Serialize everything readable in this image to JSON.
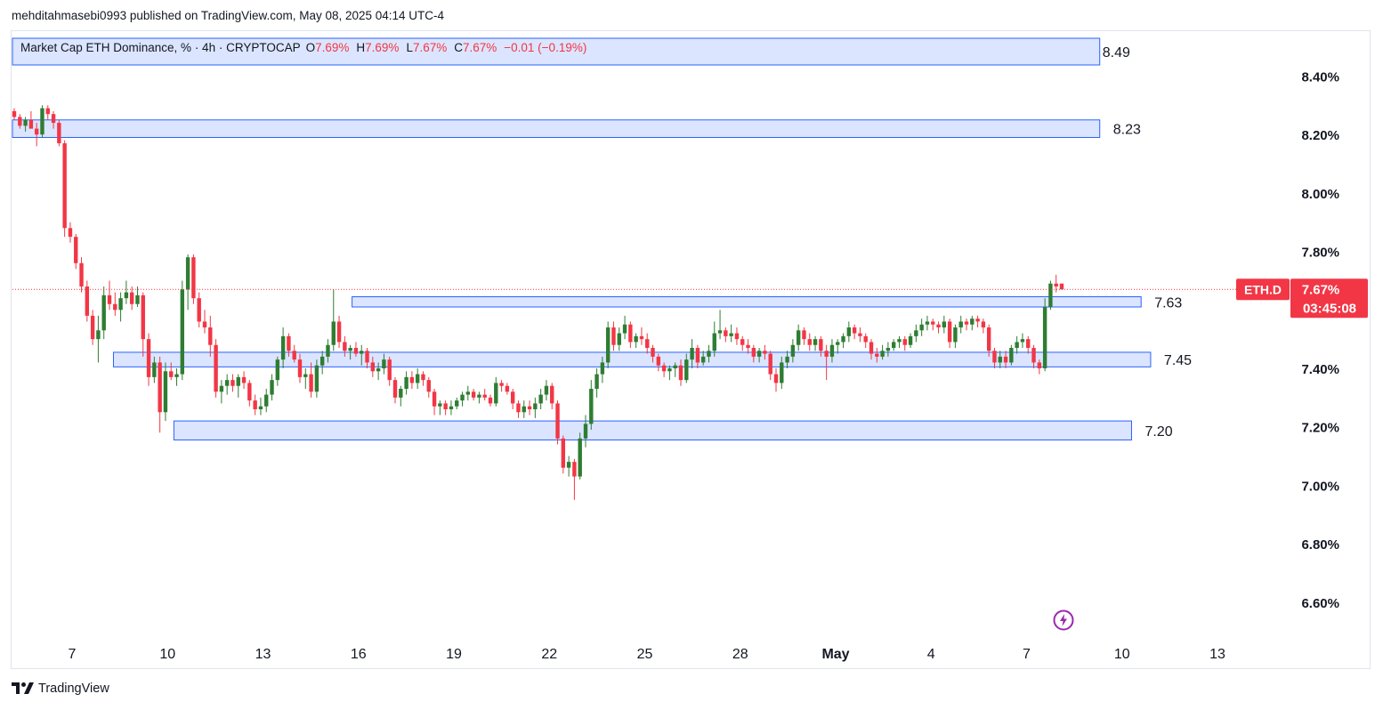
{
  "header": {
    "publisher_line": "mehditahmasebi0993 published on TradingView.com, May 08, 2025 04:14 UTC-4"
  },
  "legend": {
    "title": "Market Cap ETH Dominance, % · 4h · CRYPTOCAP",
    "o_label": "O",
    "o_value": "7.69%",
    "h_label": "H",
    "h_value": "7.69%",
    "l_label": "L",
    "l_value": "7.67%",
    "c_label": "C",
    "c_value": "7.67%",
    "change": "−0.01 (−0.19%)"
  },
  "price_tag": {
    "symbol": "ETH.D",
    "price": "7.67%",
    "countdown": "03:45:08"
  },
  "footer": {
    "brand": "TradingView"
  },
  "icons": {
    "live": "lightning-icon",
    "logo": "tradingview-logo-icon"
  },
  "colors": {
    "up": "#22ab94",
    "up_body": "#2e7d32",
    "down": "#f23645",
    "zone_fill": "#d6e0ff",
    "zone_stroke": "#2962ff",
    "axis_text": "#131722",
    "last_price_line": "#f23645",
    "live_icon": "#9c27b0"
  },
  "chart_data": {
    "type": "candlestick",
    "symbol": "ETH.D",
    "timeframe": "4h",
    "y_axis": {
      "range": [
        6.5,
        8.55
      ],
      "ticks": [
        {
          "value": 8.4,
          "label": "8.40%"
        },
        {
          "value": 8.2,
          "label": "8.20%"
        },
        {
          "value": 8.0,
          "label": "8.00%"
        },
        {
          "value": 7.8,
          "label": "7.80%"
        },
        {
          "value": 7.4,
          "label": "7.40%"
        },
        {
          "value": 7.2,
          "label": "7.20%"
        },
        {
          "value": 7.0,
          "label": "7.00%"
        },
        {
          "value": 6.8,
          "label": "6.80%"
        },
        {
          "value": 6.6,
          "label": "6.60%"
        }
      ]
    },
    "x_axis": {
      "range_days": [
        -1.4,
        38.4
      ],
      "ticks": [
        {
          "day": 3,
          "label": "7"
        },
        {
          "day": 6,
          "label": "10"
        },
        {
          "day": 9,
          "label": "13"
        },
        {
          "day": 12,
          "label": "16"
        },
        {
          "day": 15,
          "label": "19"
        },
        {
          "day": 18,
          "label": "22"
        },
        {
          "day": 21,
          "label": "25"
        },
        {
          "day": 24,
          "label": "28"
        },
        {
          "day": 27,
          "label": "May",
          "bold": true
        },
        {
          "day": 30,
          "label": "4"
        },
        {
          "day": 33,
          "label": "7"
        },
        {
          "day": 36,
          "label": "10"
        },
        {
          "day": 39,
          "label": "13"
        }
      ]
    },
    "zones": [
      {
        "name": "zone-8-49",
        "label": "8.49",
        "start_day": 0.0,
        "end_day": 32.3,
        "low": 8.45,
        "high": 8.55
      },
      {
        "name": "zone-8-23",
        "label": "8.23",
        "start_day": 0.0,
        "end_day": 32.3,
        "low": 8.19,
        "high": 8.25
      },
      {
        "name": "zone-7-63",
        "label": "7.63",
        "start_day": 9.3,
        "end_day": 33.6,
        "low": 7.61,
        "high": 7.645
      },
      {
        "name": "zone-7-45",
        "label": "7.45",
        "start_day": 1.8,
        "end_day": 33.9,
        "low": 7.405,
        "high": 7.455
      },
      {
        "name": "zone-7-20",
        "label": "7.20",
        "start_day": 3.7,
        "end_day": 33.3,
        "low": 7.155,
        "high": 7.22
      }
    ],
    "last_price": 7.67,
    "candles": [
      [
        8.28,
        8.29,
        8.25,
        8.26
      ],
      [
        8.26,
        8.27,
        8.22,
        8.23
      ],
      [
        8.23,
        8.26,
        8.21,
        8.25
      ],
      [
        8.25,
        8.28,
        8.24,
        8.22
      ],
      [
        8.22,
        8.24,
        8.16,
        8.2
      ],
      [
        8.2,
        8.3,
        8.19,
        8.29
      ],
      [
        8.29,
        8.3,
        8.25,
        8.27
      ],
      [
        8.27,
        8.28,
        8.22,
        8.24
      ],
      [
        8.24,
        8.25,
        8.16,
        8.17
      ],
      [
        8.17,
        8.18,
        7.85,
        7.88
      ],
      [
        7.88,
        7.9,
        7.83,
        7.85
      ],
      [
        7.85,
        7.86,
        7.74,
        7.76
      ],
      [
        7.76,
        7.78,
        7.66,
        7.68
      ],
      [
        7.68,
        7.7,
        7.56,
        7.58
      ],
      [
        7.58,
        7.6,
        7.48,
        7.5
      ],
      [
        7.5,
        7.58,
        7.42,
        7.53
      ],
      [
        7.53,
        7.68,
        7.5,
        7.65
      ],
      [
        7.65,
        7.7,
        7.6,
        7.62
      ],
      [
        7.62,
        7.66,
        7.58,
        7.6
      ],
      [
        7.6,
        7.66,
        7.56,
        7.64
      ],
      [
        7.64,
        7.7,
        7.62,
        7.66
      ],
      [
        7.66,
        7.68,
        7.6,
        7.62
      ],
      [
        7.62,
        7.68,
        7.61,
        7.65
      ],
      [
        7.65,
        7.66,
        7.44,
        7.5
      ],
      [
        7.5,
        7.52,
        7.34,
        7.37
      ],
      [
        7.37,
        7.44,
        7.35,
        7.42
      ],
      [
        7.42,
        7.44,
        7.18,
        7.25
      ],
      [
        7.25,
        7.42,
        7.22,
        7.39
      ],
      [
        7.39,
        7.42,
        7.36,
        7.37
      ],
      [
        7.37,
        7.4,
        7.34,
        7.38
      ],
      [
        7.38,
        7.7,
        7.36,
        7.67
      ],
      [
        7.67,
        7.79,
        7.6,
        7.78
      ],
      [
        7.78,
        7.79,
        7.62,
        7.64
      ],
      [
        7.64,
        7.66,
        7.54,
        7.56
      ],
      [
        7.56,
        7.6,
        7.52,
        7.54
      ],
      [
        7.54,
        7.58,
        7.44,
        7.48
      ],
      [
        7.48,
        7.5,
        7.3,
        7.32
      ],
      [
        7.32,
        7.36,
        7.28,
        7.34
      ],
      [
        7.34,
        7.38,
        7.31,
        7.36
      ],
      [
        7.36,
        7.38,
        7.32,
        7.34
      ],
      [
        7.34,
        7.38,
        7.3,
        7.37
      ],
      [
        7.37,
        7.39,
        7.33,
        7.35
      ],
      [
        7.35,
        7.36,
        7.27,
        7.29
      ],
      [
        7.29,
        7.31,
        7.24,
        7.26
      ],
      [
        7.26,
        7.3,
        7.24,
        7.27
      ],
      [
        7.27,
        7.33,
        7.25,
        7.31
      ],
      [
        7.31,
        7.38,
        7.29,
        7.36
      ],
      [
        7.36,
        7.44,
        7.34,
        7.43
      ],
      [
        7.43,
        7.54,
        7.4,
        7.51
      ],
      [
        7.51,
        7.52,
        7.44,
        7.46
      ],
      [
        7.46,
        7.48,
        7.42,
        7.43
      ],
      [
        7.43,
        7.45,
        7.35,
        7.37
      ],
      [
        7.37,
        7.4,
        7.33,
        7.38
      ],
      [
        7.38,
        7.42,
        7.3,
        7.32
      ],
      [
        7.32,
        7.43,
        7.3,
        7.41
      ],
      [
        7.41,
        7.46,
        7.38,
        7.44
      ],
      [
        7.44,
        7.5,
        7.42,
        7.48
      ],
      [
        7.48,
        7.67,
        7.46,
        7.56
      ],
      [
        7.56,
        7.58,
        7.47,
        7.49
      ],
      [
        7.49,
        7.51,
        7.44,
        7.46
      ],
      [
        7.46,
        7.48,
        7.43,
        7.47
      ],
      [
        7.47,
        7.49,
        7.44,
        7.45
      ],
      [
        7.45,
        7.48,
        7.41,
        7.46
      ],
      [
        7.46,
        7.47,
        7.4,
        7.42
      ],
      [
        7.42,
        7.44,
        7.37,
        7.39
      ],
      [
        7.39,
        7.42,
        7.36,
        7.4
      ],
      [
        7.4,
        7.45,
        7.38,
        7.43
      ],
      [
        7.43,
        7.44,
        7.34,
        7.36
      ],
      [
        7.36,
        7.37,
        7.28,
        7.3
      ],
      [
        7.3,
        7.34,
        7.27,
        7.33
      ],
      [
        7.33,
        7.39,
        7.31,
        7.37
      ],
      [
        7.37,
        7.39,
        7.33,
        7.35
      ],
      [
        7.35,
        7.4,
        7.33,
        7.38
      ],
      [
        7.38,
        7.39,
        7.34,
        7.36
      ],
      [
        7.36,
        7.37,
        7.3,
        7.32
      ],
      [
        7.32,
        7.33,
        7.24,
        7.27
      ],
      [
        7.27,
        7.29,
        7.24,
        7.28
      ],
      [
        7.28,
        7.29,
        7.24,
        7.26
      ],
      [
        7.26,
        7.29,
        7.24,
        7.27
      ],
      [
        7.27,
        7.3,
        7.26,
        7.29
      ],
      [
        7.29,
        7.32,
        7.27,
        7.31
      ],
      [
        7.31,
        7.34,
        7.29,
        7.32
      ],
      [
        7.32,
        7.33,
        7.29,
        7.3
      ],
      [
        7.3,
        7.32,
        7.28,
        7.31
      ],
      [
        7.31,
        7.33,
        7.29,
        7.3
      ],
      [
        7.3,
        7.31,
        7.27,
        7.28
      ],
      [
        7.28,
        7.37,
        7.27,
        7.35
      ],
      [
        7.35,
        7.36,
        7.32,
        7.34
      ],
      [
        7.34,
        7.35,
        7.31,
        7.32
      ],
      [
        7.32,
        7.33,
        7.26,
        7.28
      ],
      [
        7.28,
        7.29,
        7.23,
        7.25
      ],
      [
        7.25,
        7.29,
        7.23,
        7.27
      ],
      [
        7.27,
        7.29,
        7.24,
        7.26
      ],
      [
        7.26,
        7.3,
        7.23,
        7.28
      ],
      [
        7.28,
        7.33,
        7.26,
        7.31
      ],
      [
        7.31,
        7.36,
        7.29,
        7.34
      ],
      [
        7.34,
        7.35,
        7.26,
        7.28
      ],
      [
        7.28,
        7.29,
        7.14,
        7.16
      ],
      [
        7.16,
        7.17,
        7.04,
        7.06
      ],
      [
        7.06,
        7.1,
        7.03,
        7.08
      ],
      [
        7.08,
        7.09,
        6.95,
        7.03
      ],
      [
        7.03,
        7.18,
        7.02,
        7.16
      ],
      [
        7.16,
        7.24,
        7.13,
        7.21
      ],
      [
        7.21,
        7.36,
        7.19,
        7.33
      ],
      [
        7.33,
        7.4,
        7.3,
        7.38
      ],
      [
        7.38,
        7.44,
        7.35,
        7.42
      ],
      [
        7.42,
        7.56,
        7.4,
        7.54
      ],
      [
        7.54,
        7.56,
        7.46,
        7.48
      ],
      [
        7.48,
        7.54,
        7.46,
        7.52
      ],
      [
        7.52,
        7.58,
        7.5,
        7.55
      ],
      [
        7.55,
        7.56,
        7.47,
        7.49
      ],
      [
        7.49,
        7.52,
        7.47,
        7.51
      ],
      [
        7.51,
        7.54,
        7.48,
        7.5
      ],
      [
        7.5,
        7.52,
        7.45,
        7.47
      ],
      [
        7.47,
        7.48,
        7.42,
        7.44
      ],
      [
        7.44,
        7.45,
        7.39,
        7.41
      ],
      [
        7.41,
        7.42,
        7.37,
        7.39
      ],
      [
        7.39,
        7.41,
        7.36,
        7.4
      ],
      [
        7.4,
        7.42,
        7.37,
        7.41
      ],
      [
        7.41,
        7.43,
        7.34,
        7.36
      ],
      [
        7.36,
        7.45,
        7.35,
        7.43
      ],
      [
        7.43,
        7.5,
        7.4,
        7.47
      ],
      [
        7.47,
        7.48,
        7.4,
        7.42
      ],
      [
        7.42,
        7.46,
        7.41,
        7.44
      ],
      [
        7.44,
        7.48,
        7.42,
        7.46
      ],
      [
        7.46,
        7.56,
        7.44,
        7.52
      ],
      [
        7.52,
        7.6,
        7.5,
        7.53
      ],
      [
        7.53,
        7.54,
        7.49,
        7.51
      ],
      [
        7.51,
        7.55,
        7.49,
        7.52
      ],
      [
        7.52,
        7.54,
        7.48,
        7.5
      ],
      [
        7.5,
        7.51,
        7.46,
        7.48
      ],
      [
        7.48,
        7.5,
        7.45,
        7.47
      ],
      [
        7.47,
        7.48,
        7.42,
        7.44
      ],
      [
        7.44,
        7.47,
        7.42,
        7.46
      ],
      [
        7.46,
        7.48,
        7.43,
        7.45
      ],
      [
        7.45,
        7.46,
        7.36,
        7.38
      ],
      [
        7.38,
        7.4,
        7.32,
        7.35
      ],
      [
        7.35,
        7.44,
        7.33,
        7.42
      ],
      [
        7.42,
        7.46,
        7.4,
        7.44
      ],
      [
        7.44,
        7.5,
        7.42,
        7.48
      ],
      [
        7.48,
        7.55,
        7.46,
        7.53
      ],
      [
        7.53,
        7.54,
        7.48,
        7.5
      ],
      [
        7.5,
        7.52,
        7.46,
        7.48
      ],
      [
        7.48,
        7.51,
        7.46,
        7.5
      ],
      [
        7.5,
        7.51,
        7.44,
        7.46
      ],
      [
        7.46,
        7.48,
        7.36,
        7.44
      ],
      [
        7.44,
        7.5,
        7.42,
        7.48
      ],
      [
        7.48,
        7.5,
        7.45,
        7.49
      ],
      [
        7.49,
        7.52,
        7.47,
        7.51
      ],
      [
        7.51,
        7.56,
        7.49,
        7.54
      ],
      [
        7.54,
        7.55,
        7.5,
        7.52
      ],
      [
        7.52,
        7.54,
        7.49,
        7.51
      ],
      [
        7.51,
        7.52,
        7.47,
        7.49
      ],
      [
        7.49,
        7.5,
        7.43,
        7.45
      ],
      [
        7.45,
        7.47,
        7.42,
        7.44
      ],
      [
        7.44,
        7.48,
        7.43,
        7.46
      ],
      [
        7.46,
        7.49,
        7.44,
        7.47
      ],
      [
        7.47,
        7.5,
        7.46,
        7.49
      ],
      [
        7.49,
        7.51,
        7.47,
        7.5
      ],
      [
        7.5,
        7.51,
        7.46,
        7.48
      ],
      [
        7.48,
        7.52,
        7.47,
        7.51
      ],
      [
        7.51,
        7.55,
        7.49,
        7.53
      ],
      [
        7.53,
        7.57,
        7.51,
        7.55
      ],
      [
        7.55,
        7.58,
        7.53,
        7.56
      ],
      [
        7.56,
        7.57,
        7.53,
        7.55
      ],
      [
        7.55,
        7.56,
        7.52,
        7.54
      ],
      [
        7.54,
        7.58,
        7.52,
        7.56
      ],
      [
        7.56,
        7.57,
        7.47,
        7.49
      ],
      [
        7.49,
        7.55,
        7.47,
        7.54
      ],
      [
        7.54,
        7.58,
        7.52,
        7.56
      ],
      [
        7.56,
        7.57,
        7.53,
        7.55
      ],
      [
        7.55,
        7.58,
        7.53,
        7.57
      ],
      [
        7.57,
        7.58,
        7.54,
        7.56
      ],
      [
        7.56,
        7.57,
        7.52,
        7.54
      ],
      [
        7.54,
        7.55,
        7.44,
        7.46
      ],
      [
        7.46,
        7.47,
        7.4,
        7.42
      ],
      [
        7.42,
        7.46,
        7.4,
        7.44
      ],
      [
        7.44,
        7.46,
        7.4,
        7.42
      ],
      [
        7.42,
        7.48,
        7.41,
        7.47
      ],
      [
        7.47,
        7.51,
        7.45,
        7.49
      ],
      [
        7.49,
        7.52,
        7.47,
        7.5
      ],
      [
        7.5,
        7.51,
        7.45,
        7.47
      ],
      [
        7.47,
        7.48,
        7.4,
        7.42
      ],
      [
        7.42,
        7.43,
        7.38,
        7.4
      ],
      [
        7.4,
        7.64,
        7.39,
        7.61
      ],
      [
        7.61,
        7.7,
        7.6,
        7.69
      ],
      [
        7.69,
        7.72,
        7.66,
        7.68
      ],
      [
        7.69,
        7.69,
        7.67,
        7.67
      ]
    ]
  }
}
